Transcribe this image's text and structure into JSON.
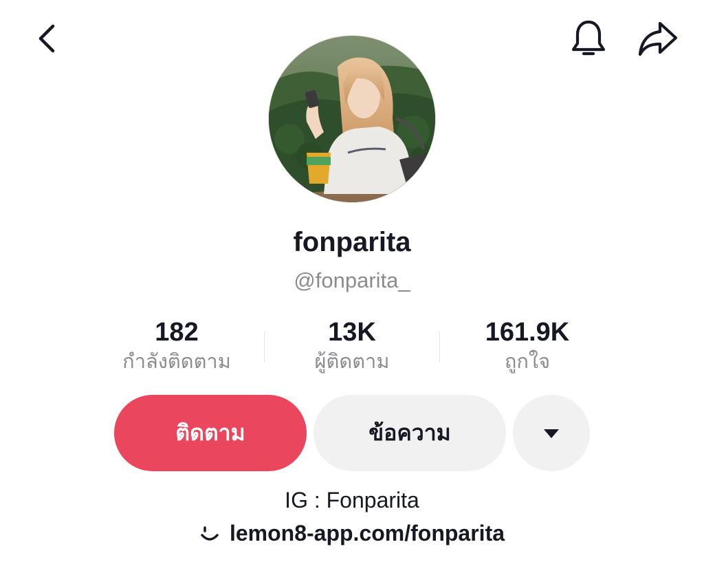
{
  "header": {
    "back_icon": "chevron-left-icon",
    "bell_icon": "bell-icon",
    "share_icon": "share-arrow-icon"
  },
  "profile": {
    "display_name": "fonparita",
    "username": "@fonparita_"
  },
  "stats": [
    {
      "value": "182",
      "label": "กำลังติดตาม"
    },
    {
      "value": "13K",
      "label": "ผู้ติดตาม"
    },
    {
      "value": "161.9K",
      "label": "ถูกใจ"
    }
  ],
  "actions": {
    "follow_label": "ติดตาม",
    "message_label": "ข้อความ",
    "more_icon": "caret-down-icon"
  },
  "bio": {
    "line1": "IG : Fonparita",
    "link_icon": "lemon8-smile-icon",
    "link_text": "lemon8-app.com/fonparita"
  },
  "colors": {
    "follow_button": "#ea465d",
    "secondary_button": "#f1f1f2",
    "muted_text": "#8a8b91",
    "primary_text": "#161823"
  }
}
